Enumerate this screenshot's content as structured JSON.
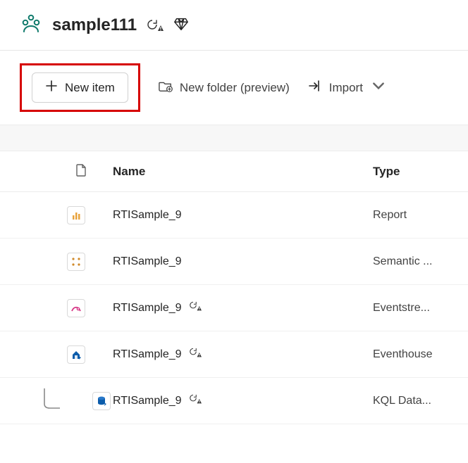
{
  "header": {
    "workspace_title": "sample111"
  },
  "toolbar": {
    "new_item_label": "New item",
    "new_folder_label": "New folder (preview)",
    "import_label": "Import"
  },
  "table": {
    "columns": {
      "name": "Name",
      "type": "Type"
    },
    "rows": [
      {
        "name": "RTISample_9",
        "type": "Report",
        "icon": "report",
        "warn": false,
        "nested": false
      },
      {
        "name": "RTISample_9",
        "type": "Semantic ...",
        "icon": "semantic",
        "warn": false,
        "nested": false
      },
      {
        "name": "RTISample_9",
        "type": "Eventstre...",
        "icon": "eventstream",
        "warn": true,
        "nested": false
      },
      {
        "name": "RTISample_9",
        "type": "Eventhouse",
        "icon": "eventhouse",
        "warn": true,
        "nested": false
      },
      {
        "name": "RTISample_9",
        "type": "KQL Data...",
        "icon": "kqldb",
        "warn": true,
        "nested": true
      }
    ]
  }
}
